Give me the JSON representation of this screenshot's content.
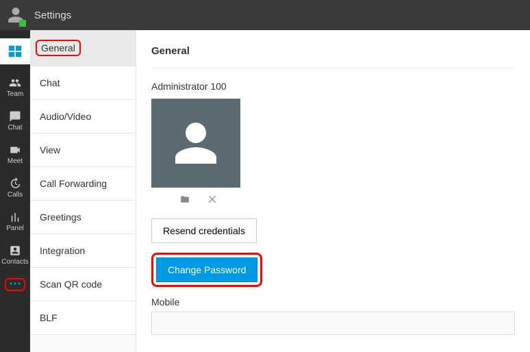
{
  "topbar": {
    "title": "Settings"
  },
  "rail": {
    "items": [
      {
        "label": ""
      },
      {
        "label": "Team"
      },
      {
        "label": "Chat"
      },
      {
        "label": "Meet"
      },
      {
        "label": "Calls"
      },
      {
        "label": "Panel"
      },
      {
        "label": "Contacts"
      }
    ]
  },
  "settingsNav": {
    "items": [
      {
        "label": "General",
        "active": true
      },
      {
        "label": "Chat"
      },
      {
        "label": "Audio/Video"
      },
      {
        "label": "View"
      },
      {
        "label": "Call Forwarding"
      },
      {
        "label": "Greetings"
      },
      {
        "label": "Integration"
      },
      {
        "label": "Scan QR code"
      },
      {
        "label": "BLF"
      }
    ]
  },
  "content": {
    "heading": "General",
    "userName": "Administrator 100",
    "resendBtn": "Resend credentials",
    "changePwBtn": "Change Password",
    "mobileLabel": "Mobile",
    "mobileValue": ""
  }
}
